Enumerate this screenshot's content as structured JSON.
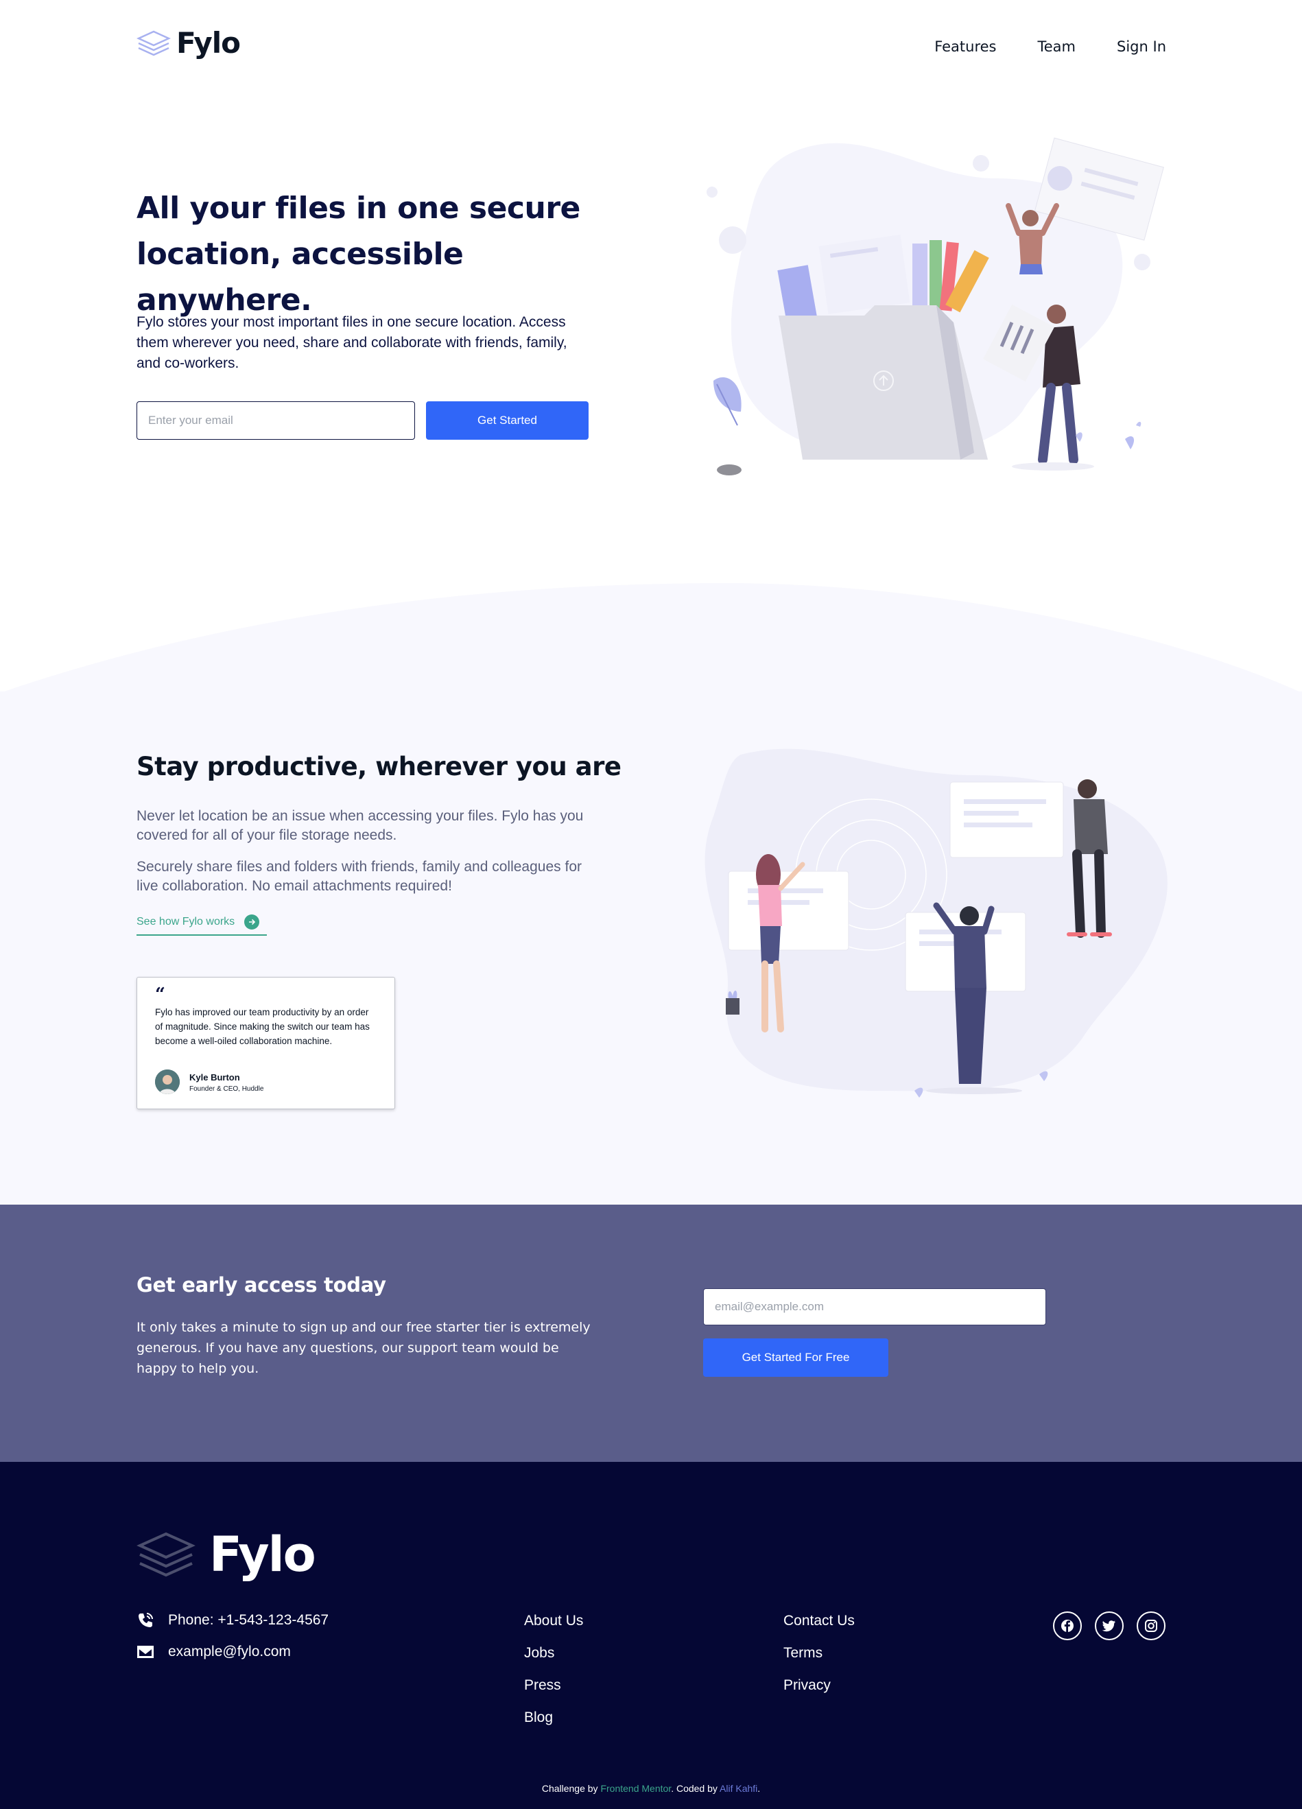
{
  "header": {
    "logo_text": "Fylo",
    "nav": [
      {
        "label": "Features"
      },
      {
        "label": "Team"
      },
      {
        "label": "Sign In"
      }
    ]
  },
  "hero": {
    "title": "All your files in one secure location, accessible anywhere.",
    "description": "Fylo stores your most important files in one secure location. Access them wherever you need, share and collaborate with friends, family, and co-workers.",
    "email_placeholder": "Enter your email",
    "cta_label": "Get Started"
  },
  "productive": {
    "title": "Stay productive, wherever you are",
    "paragraph_1": "Never let location be an issue when accessing your files. Fylo has you covered for all of your file storage needs.",
    "paragraph_2": "Securely share files and folders with friends, family and colleagues for live collaboration. No email attachments required!",
    "link_label": "See how Fylo works",
    "testimonial": {
      "quote_mark": "“",
      "text": "Fylo has improved our team productivity by an order of magnitude. Since making the switch our team has become a well-oiled collaboration machine.",
      "name": "Kyle Burton",
      "role": "Founder & CEO, Huddle"
    }
  },
  "early_access": {
    "title": "Get early access today",
    "description": "It only takes a minute to sign up and our free starter tier is extremely generous. If you have any questions, our support team would be happy to help you.",
    "email_placeholder": "email@example.com",
    "cta_label": "Get Started For Free"
  },
  "footer": {
    "logo_text": "Fylo",
    "phone": "Phone: +1-543-123-4567",
    "email": "example@fylo.com",
    "links_col1": [
      {
        "label": "About Us"
      },
      {
        "label": "Jobs"
      },
      {
        "label": "Press"
      },
      {
        "label": "Blog"
      }
    ],
    "links_col2": [
      {
        "label": "Contact Us"
      },
      {
        "label": "Terms"
      },
      {
        "label": "Privacy"
      }
    ],
    "socials": [
      "facebook-icon",
      "twitter-icon",
      "instagram-icon"
    ],
    "attribution": {
      "prefix": "Challenge by ",
      "fm_label": "Frontend Mentor",
      "middle": ". Coded by ",
      "author_label": "Alif Kahfi",
      "suffix": "."
    }
  },
  "colors": {
    "primary_blue": "#3066f8",
    "dark_navy": "#050734",
    "early_bg": "#5a5d8a",
    "accent_teal": "#3ba58b",
    "light_bg": "#f8f8fe"
  }
}
